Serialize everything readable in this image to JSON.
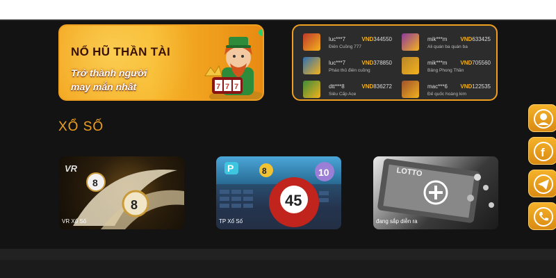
{
  "banner": {
    "title": "NỔ HŨ THẦN TÀI",
    "subtitle_line1": "Trở thành người",
    "subtitle_line2": "may mắn nhất"
  },
  "winners": [
    {
      "user": "luc***7",
      "currency": "VND",
      "amount": "344550",
      "game": "Điên Cuồng 777",
      "thumb_color": "#c0392b"
    },
    {
      "user": "mik***m",
      "currency": "VND",
      "amount": "633425",
      "game": "Ali quán ba quán ba",
      "thumb_color": "#8e3a9c"
    },
    {
      "user": "luc***7",
      "currency": "VND",
      "amount": "378850",
      "game": "Pháo thủ điên cuồng",
      "thumb_color": "#2f6fb3"
    },
    {
      "user": "mik***m",
      "currency": "VND",
      "amount": "705560",
      "game": "Bảng Phong Thần",
      "thumb_color": "#b8862b"
    },
    {
      "user": "dtt***8",
      "currency": "VND",
      "amount": "836272",
      "game": "Siêu Cấp Ace",
      "thumb_color": "#3d8b3a"
    },
    {
      "user": "mac***6",
      "currency": "VND",
      "amount": "122535",
      "game": "Đế quốc hoàng kim",
      "thumb_color": "#a0522d"
    }
  ],
  "section": {
    "title": "XỔ SỐ"
  },
  "cards": [
    {
      "label": "VR Xổ Số"
    },
    {
      "label": "TP Xổ Số"
    },
    {
      "label": "đang sắp diễn ra"
    }
  ],
  "side_buttons": [
    {
      "icon": "support-agent-icon"
    },
    {
      "icon": "facebook-icon"
    },
    {
      "icon": "telegram-icon"
    },
    {
      "icon": "phone-icon"
    }
  ],
  "colors": {
    "accent": "#f0a020",
    "background": "#131313",
    "amount_currency": "#f3b21d"
  }
}
